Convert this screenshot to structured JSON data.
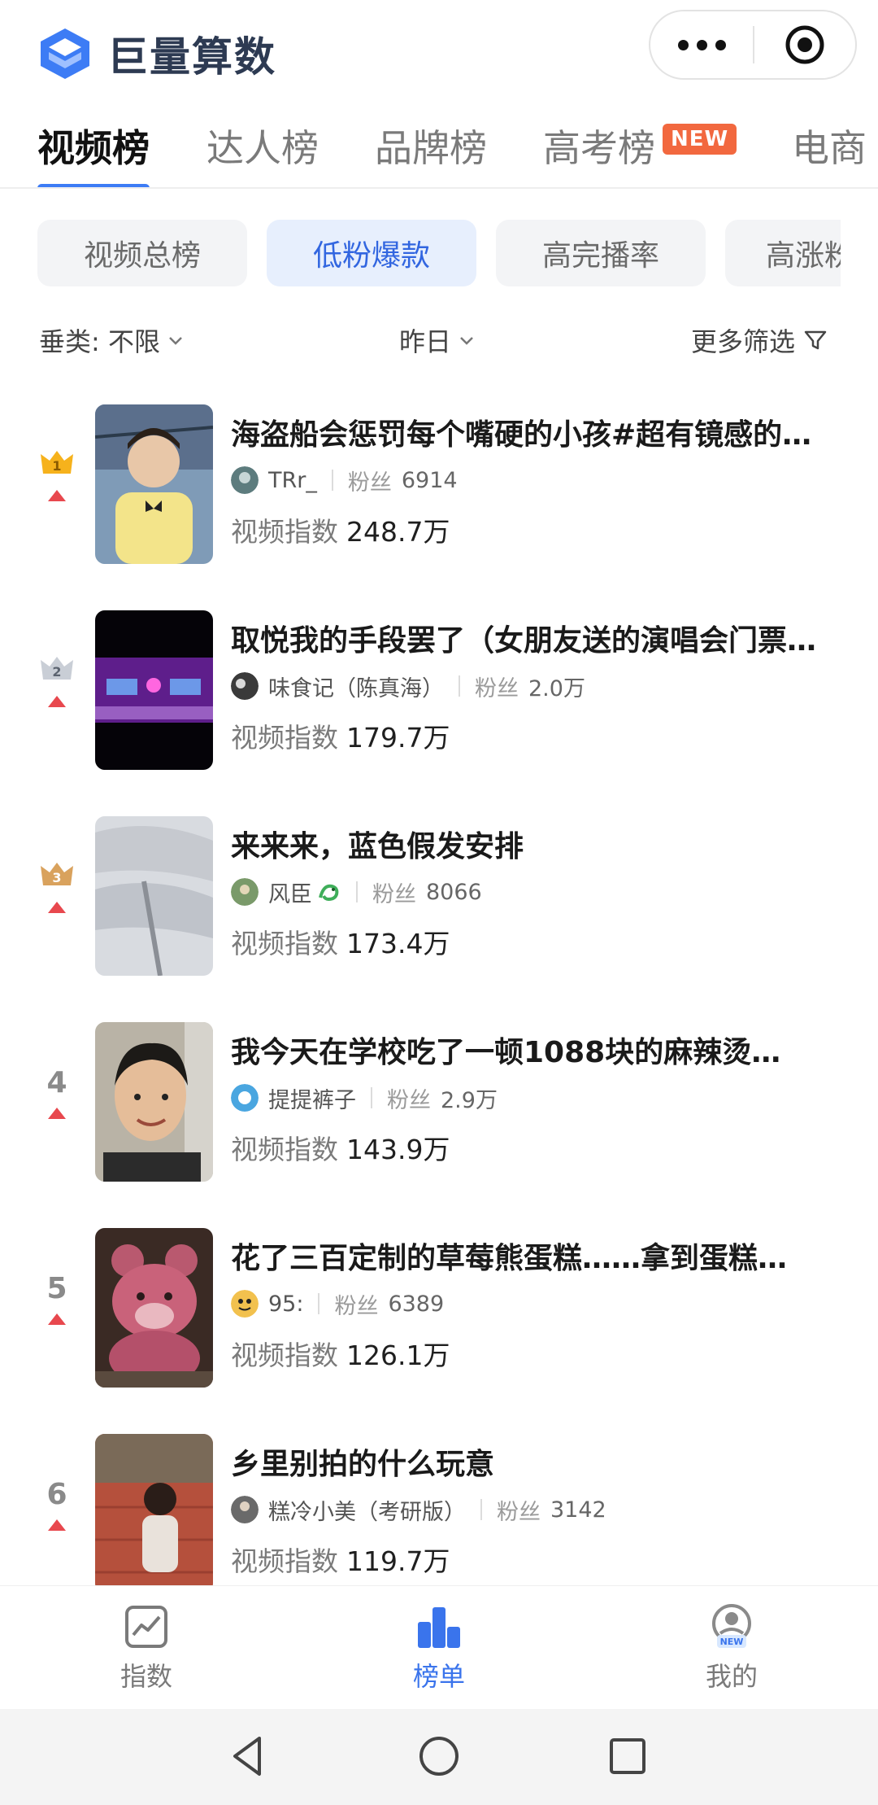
{
  "app": {
    "title": "巨量算数"
  },
  "main_tabs": [
    {
      "label": "视频榜"
    },
    {
      "label": "达人榜"
    },
    {
      "label": "品牌榜"
    },
    {
      "label": "高考榜",
      "badge": "NEW"
    },
    {
      "label": "电商"
    }
  ],
  "sub_tabs": [
    {
      "label": "视频总榜"
    },
    {
      "label": "低粉爆款"
    },
    {
      "label": "高完播率"
    },
    {
      "label": "高涨粉"
    }
  ],
  "filters": {
    "category": "垂类: 不限",
    "date": "昨日",
    "more": "更多筛选"
  },
  "list": {
    "fans_label": "粉丝",
    "index_label": "视频指数",
    "items": [
      {
        "rank": "1",
        "title": "海盗船会惩罚每个嘴硬的小孩#超有镜感的…",
        "author": "TRr_",
        "fans": "6914",
        "index": "248.7万"
      },
      {
        "rank": "2",
        "title": "取悦我的手段罢了（女朋友送的演唱会门票…",
        "author": "味食记（陈真海）",
        "fans": "2.0万",
        "index": "179.7万"
      },
      {
        "rank": "3",
        "title": "来来来，蓝色假发安排",
        "author": "风臣",
        "fans": "8066",
        "index": "173.4万"
      },
      {
        "rank": "4",
        "title": "我今天在学校吃了一顿1088块的麻辣烫…",
        "author": "提提裤子",
        "fans": "2.9万",
        "index": "143.9万"
      },
      {
        "rank": "5",
        "title": "花了三百定制的草莓熊蛋糕……拿到蛋糕…",
        "author": "95:",
        "fans": "6389",
        "index": "126.1万"
      },
      {
        "rank": "6",
        "title": "乡里别拍的什么玩意",
        "author": "糕冷小美（考研版）",
        "fans": "3142",
        "index": "119.7万"
      }
    ]
  },
  "bottom_nav": [
    {
      "label": "指数"
    },
    {
      "label": "榜单"
    },
    {
      "label": "我的",
      "badge": "NEW"
    }
  ]
}
